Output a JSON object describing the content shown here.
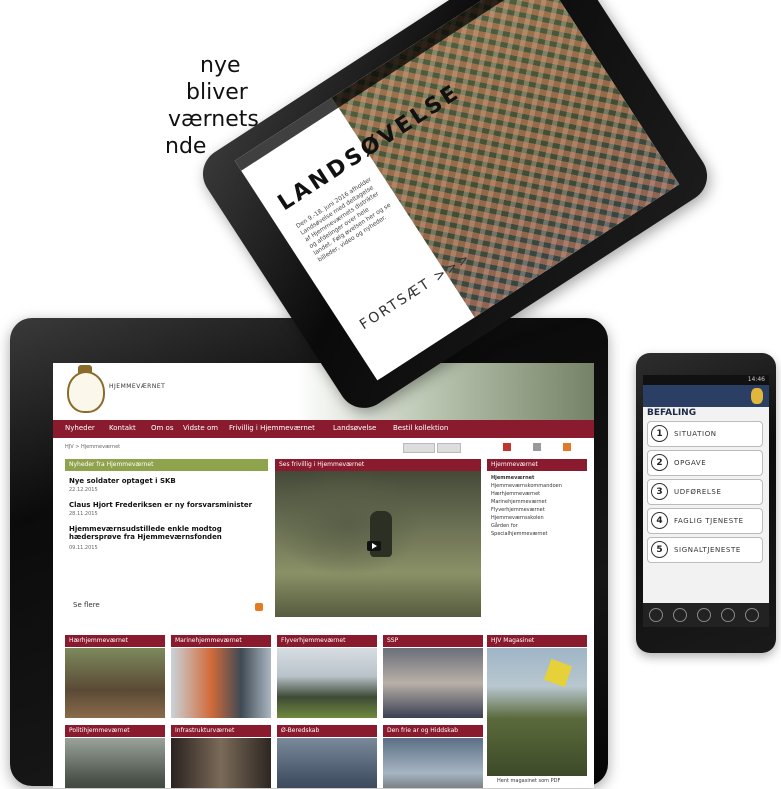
{
  "intro": {
    "line1": "nye",
    "line2": "bliver",
    "line3": "værnets",
    "line4": "nde"
  },
  "android": {
    "title": "LANDSØVELSE",
    "body": "Den 9.-18. juni 2016 afholder Landsøvelse med deltagelse af Hjemmeværnets distrikter og afdelinger over hele landet. Følg øvelsen her og se billeder, video og nyheder.",
    "cta": "FORTSÆT >>>"
  },
  "phone": {
    "clock": "14:46",
    "heading": "BEFALING",
    "items": [
      {
        "num": "1",
        "label": "SITUATION"
      },
      {
        "num": "2",
        "label": "OPGAVE"
      },
      {
        "num": "3",
        "label": "UDFØRELSE"
      },
      {
        "num": "4",
        "label": "FAGLIG TJENESTE"
      },
      {
        "num": "5",
        "label": "SIGNALTJENESTE"
      }
    ]
  },
  "website": {
    "site_name": "HJEMMEVÆRNET",
    "nav": [
      "Nyheder",
      "Kontakt",
      "Om os",
      "Vidste om",
      "Frivillig i Hjemmeværnet",
      "Landsøvelse",
      "Bestil kollektion"
    ],
    "breadcrumb": "HJV > Hjemmeværnet",
    "news_header": "Nyheder fra Hjemmeværnet",
    "news": [
      {
        "title": "Nye soldater optaget i SKB",
        "date": "22.12.2015"
      },
      {
        "title": "Claus Hjort Frederiksen er ny forsvarsminister",
        "date": "28.11.2015"
      },
      {
        "title": "Hjemmeværnsudstillede enkle modtog hædersprøve fra Hjemmeværnsfonden",
        "date": "09.11.2015"
      }
    ],
    "see_all": "Se flere",
    "video_header": "Ses frivillig i Hjemmeværnet",
    "side_header": "Hjemmeværnet",
    "side_links": [
      "Hjemmeværnet",
      "Hjemmeværnskommandoen",
      "Hærhjemmeværnet",
      "Marinehjemmeværnet",
      "Flyverhjemmeværnet",
      "Hjemmeværnsskolen",
      "Gården for",
      "Specialhjemmeværnet"
    ],
    "tiles": [
      "Hærhjemmeværnet",
      "Marinehjemmeværnet",
      "Flyverhjemmeværnet",
      "SSP",
      "Politihjemmeværnet",
      "Infrastrukturværnet",
      "Ø-Beredskab",
      "Den frie ar og Hiddskab"
    ],
    "magazine_header": "HJV Magasinet",
    "magazine_link": "Hent magasinet som PDF"
  }
}
